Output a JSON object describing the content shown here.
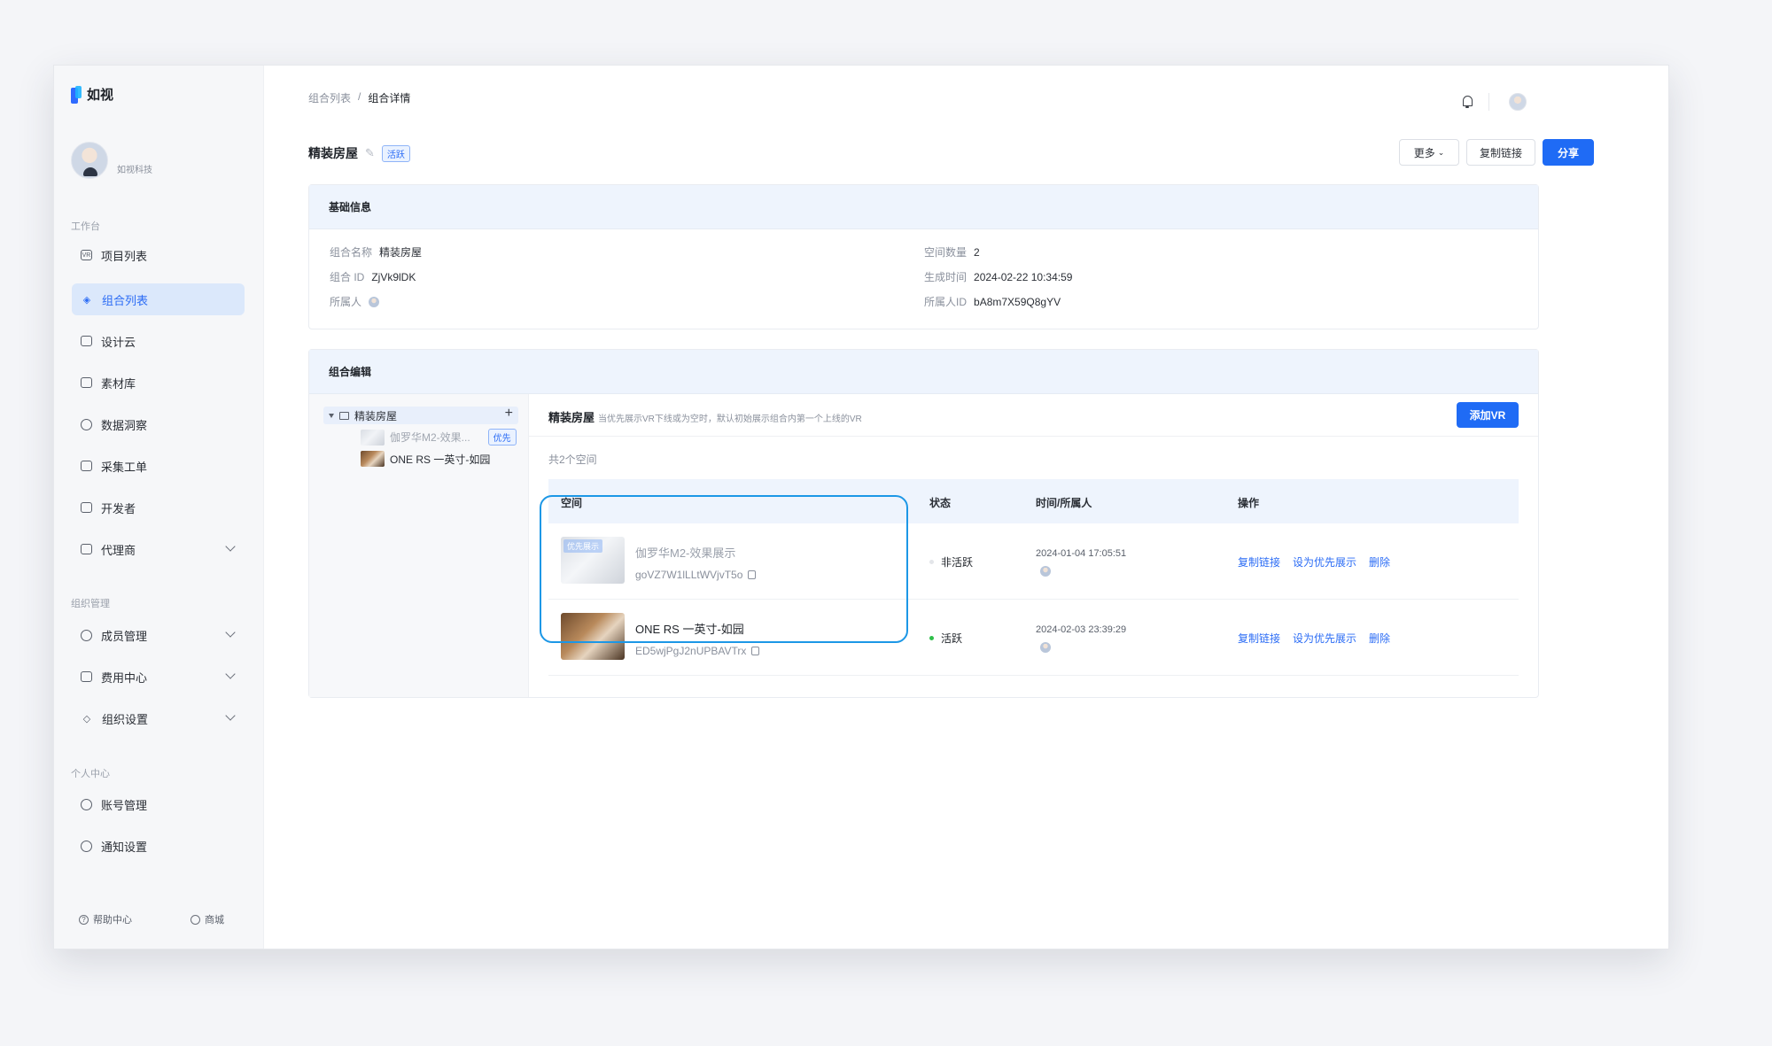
{
  "app": {
    "logo_text": "如视",
    "company": "如视科技",
    "colors": {
      "primary": "#1f6bf5",
      "active_bg": "#dbe8fb",
      "highlight": "#1c97e6",
      "status_active": "#2fbf4a"
    }
  },
  "sidebar": {
    "groups": {
      "workspace": "工作台",
      "org": "组织管理",
      "personal": "个人中心"
    },
    "items": [
      {
        "label": "项目列表",
        "icon": "vr-icon"
      },
      {
        "label": "组合列表",
        "icon": "layers-icon",
        "active": true
      },
      {
        "label": "设计云",
        "icon": "monitor-icon"
      },
      {
        "label": "素材库",
        "icon": "folder-icon"
      },
      {
        "label": "数据洞察",
        "icon": "chart-pie-icon"
      },
      {
        "label": "采集工单",
        "icon": "document-icon"
      },
      {
        "label": "开发者",
        "icon": "code-icon"
      },
      {
        "label": "代理商",
        "icon": "briefcase-icon",
        "expandable": true
      },
      {
        "label": "成员管理",
        "icon": "users-icon",
        "expandable": true
      },
      {
        "label": "费用中心",
        "icon": "wallet-icon",
        "expandable": true
      },
      {
        "label": "组织设置",
        "icon": "diamond-icon",
        "expandable": true
      },
      {
        "label": "账号管理",
        "icon": "user-icon"
      },
      {
        "label": "通知设置",
        "icon": "bell-settings-icon"
      }
    ],
    "footer": {
      "help": "帮助中心",
      "shop": "商城"
    }
  },
  "header": {
    "breadcrumb": [
      "组合列表",
      "组合详情"
    ],
    "separator": "/",
    "title": "精装房屋",
    "status_tag": "活跃",
    "more_label": "更多",
    "copy_link_label": "复制链接",
    "share_label": "分享"
  },
  "basic_info": {
    "heading": "基础信息",
    "name_label": "组合名称",
    "name_value": "精装房屋",
    "id_label": "组合 ID",
    "id_value": "ZjVk9lDK",
    "owner_label": "所属人",
    "space_count_label": "空间数量",
    "space_count_value": "2",
    "created_label": "生成时间",
    "created_value": "2024-02-22 10:34:59",
    "owner_id_label": "所属人ID",
    "owner_id_value": "bA8m7X59Q8gYV"
  },
  "edit": {
    "heading": "组合编辑",
    "tree": {
      "root": "精装房屋",
      "children": [
        {
          "label": "伽罗华M2-效果...",
          "tag": "优先"
        },
        {
          "label": "ONE RS 一英寸-如园"
        }
      ]
    },
    "panel_title": "精装房屋",
    "panel_hint": "当优先展示VR下线或为空时，默认初始展示组合内第一个上线的VR",
    "add_vr_label": "添加VR",
    "count_text": "共2个空间",
    "columns": [
      "空间",
      "状态",
      "时间/所属人",
      "操作"
    ],
    "rows": [
      {
        "name": "伽罗华M2-效果展示",
        "code": "goVZ7W1lLLtWVjvT5o",
        "priority_badge": "优先展示",
        "status": "非活跃",
        "time": "2024-01-04 17:05:51",
        "ops": [
          "复制链接",
          "设为优先展示",
          "删除"
        ]
      },
      {
        "name": "ONE RS 一英寸-如园",
        "code": "ED5wjPgJ2nUPBAVTrx",
        "status": "活跃",
        "time": "2024-02-03 23:39:29",
        "ops": [
          "复制链接",
          "设为优先展示",
          "删除"
        ]
      }
    ]
  }
}
